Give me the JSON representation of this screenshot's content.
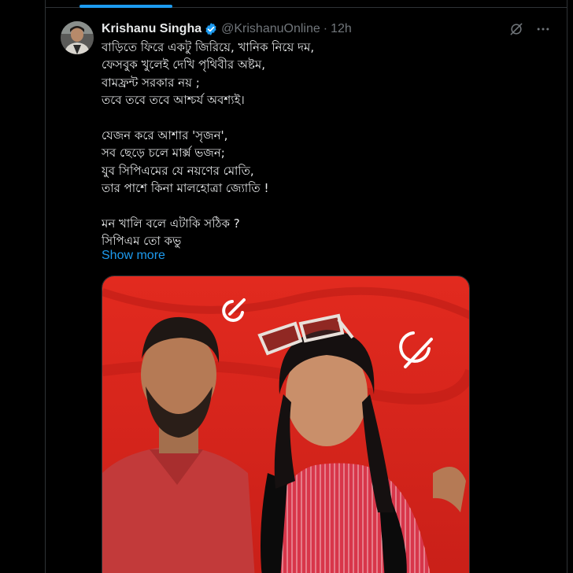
{
  "tweet": {
    "author_name": "Krishanu Singha",
    "handle": "@KrishanuOnline",
    "separator": "·",
    "time": "12h",
    "lines": [
      "বাড়িতে ফিরে একটু জিরিয়ে, খানিক নিয়ে দম,",
      "ফেসবুক খুলেই দেখি পৃথিবীর অষ্টম,",
      "বামফ্রন্ট সরকার নয় ;",
      "তবে তবে তবে আশ্চর্য অবশ্যই।",
      "",
      "যেজন করে আশার 'সৃজন',",
      "সব ছেড়ে চলে মার্ক্স ভজন;",
      "যুব সিপিএমের যে নয়ণের মোতি,",
      "তার পাশে কিনা মালহোত্রা জ্যোতি !",
      "",
      "মন খালি বলে এটাকি সঠিক ?",
      "সিপিএম তো কভু"
    ],
    "show_more_label": "Show more"
  },
  "icons": {
    "verified": "verified-badge-icon",
    "grok": "grok-icon",
    "more": "more-icon"
  },
  "colors": {
    "background": "#000000",
    "text": "#e7e9ea",
    "muted": "#71767b",
    "accent": "#1d9bf0",
    "border": "#2f3336",
    "flag_red": "#d7261e"
  }
}
